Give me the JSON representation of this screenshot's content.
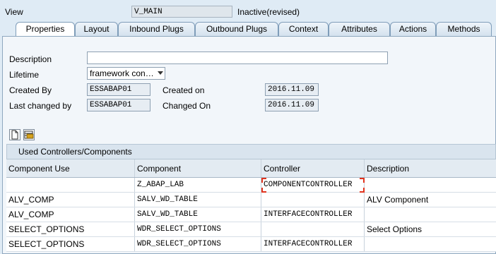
{
  "header": {
    "view_label": "View",
    "view_value": "V_MAIN",
    "status": "Inactive(revised)"
  },
  "tabs": [
    {
      "label": "Properties",
      "active": true
    },
    {
      "label": "Layout"
    },
    {
      "label": "Inbound Plugs"
    },
    {
      "label": "Outbound Plugs"
    },
    {
      "label": "Context"
    },
    {
      "label": "Attributes"
    },
    {
      "label": "Actions"
    },
    {
      "label": "Methods"
    }
  ],
  "properties": {
    "description_label": "Description",
    "description_value": "",
    "lifetime_label": "Lifetime",
    "lifetime_value": "framework con…",
    "created_by_label": "Created By",
    "created_by_value": "ESSABAP01",
    "created_on_label": "Created on",
    "created_on_value": "2016.11.09",
    "last_changed_by_label": "Last changed by",
    "last_changed_by_value": "ESSABAP01",
    "changed_on_label": "Changed On",
    "changed_on_value": "2016.11.09"
  },
  "toolbar": {
    "icons": [
      "new-document-icon",
      "delete-row-icon"
    ]
  },
  "table": {
    "title": "Used Controllers/Components",
    "columns": [
      "Component Use",
      "Component",
      "Controller",
      "Description"
    ],
    "rows": [
      [
        "",
        "Z_ABAP_LAB",
        "COMPONENTCONTROLLER",
        ""
      ],
      [
        "ALV_COMP",
        "SALV_WD_TABLE",
        "",
        "ALV Component"
      ],
      [
        "ALV_COMP",
        "SALV_WD_TABLE",
        "INTERFACECONTROLLER",
        ""
      ],
      [
        "SELECT_OPTIONS",
        "WDR_SELECT_OPTIONS",
        "",
        "Select Options"
      ],
      [
        "SELECT_OPTIONS",
        "WDR_SELECT_OPTIONS",
        "INTERFACECONTROLLER",
        ""
      ]
    ]
  },
  "colors": {
    "background": "#dfebf5",
    "focus_corner": "#e0341f"
  }
}
